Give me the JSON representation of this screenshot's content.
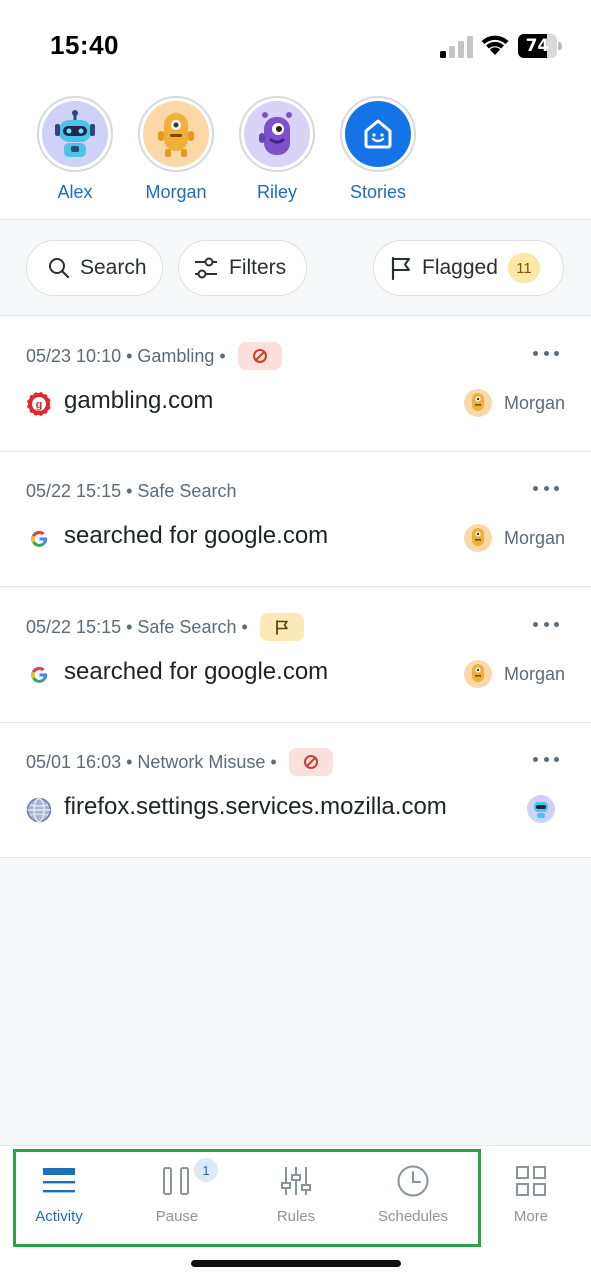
{
  "status_bar": {
    "time": "15:40",
    "battery_level": "74"
  },
  "profiles": [
    {
      "name": "Alex",
      "avatar_color": "#cfd2f6"
    },
    {
      "name": "Morgan",
      "avatar_color": "#fcd7a8"
    },
    {
      "name": "Riley",
      "avatar_color": "#d9d4f5"
    },
    {
      "name": "Stories",
      "avatar_color": "#1473e6"
    }
  ],
  "filters": {
    "search_label": "Search",
    "filters_label": "Filters",
    "flagged_label": "Flagged",
    "flagged_count": "11"
  },
  "activity": [
    {
      "meta": "05/23 10:10 • Gambling •",
      "tag": "block",
      "site": "gambling.com",
      "icon": "gambling-icon",
      "user": "Morgan"
    },
    {
      "meta": "05/22 15:15 • Safe Search",
      "tag": "",
      "site": "searched for google.com",
      "icon": "google-icon",
      "user": "Morgan"
    },
    {
      "meta": "05/22 15:15 • Safe Search •",
      "tag": "flag",
      "site": "searched for google.com",
      "icon": "google-icon",
      "user": "Morgan"
    },
    {
      "meta": "05/01 16:03 • Network Misuse •",
      "tag": "block",
      "site": "firefox.settings.services.mozilla.com",
      "icon": "globe-icon",
      "user": ""
    }
  ],
  "tabs": [
    {
      "label": "Activity",
      "icon": "activity-icon",
      "active": true
    },
    {
      "label": "Pause",
      "icon": "pause-icon",
      "badge": "1"
    },
    {
      "label": "Rules",
      "icon": "rules-icon"
    },
    {
      "label": "Schedules",
      "icon": "clock-icon"
    },
    {
      "label": "More",
      "icon": "grid-icon"
    }
  ],
  "colors": {
    "accent": "#1a6fb8",
    "block_tag": "#fbe1dd",
    "flag_tag": "#fbe9b7",
    "highlight": "#2aa34a"
  }
}
